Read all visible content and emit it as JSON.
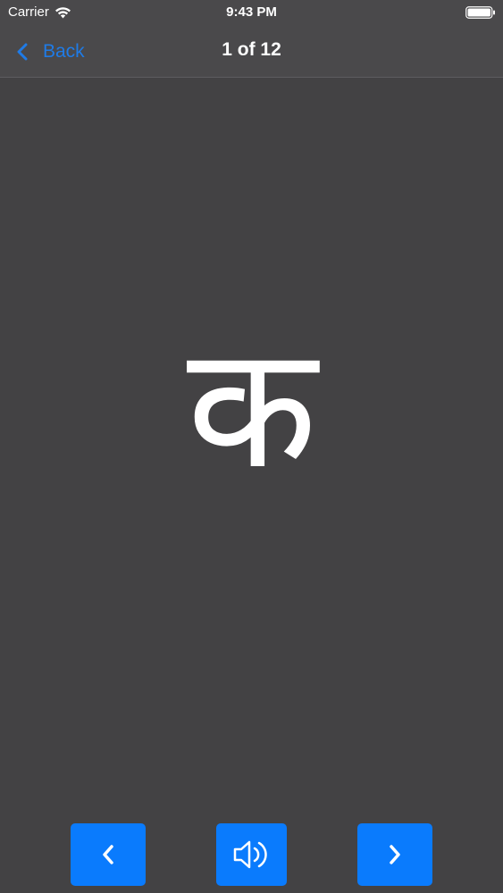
{
  "status_bar": {
    "carrier": "Carrier",
    "time": "9:43 PM",
    "wifi_icon": "wifi-icon",
    "battery_icon": "battery-icon"
  },
  "nav": {
    "back_label": "Back",
    "title": "1 of 12",
    "back_icon": "chevron-left-icon"
  },
  "content": {
    "letter": "क"
  },
  "controls": {
    "prev_icon": "chevron-left-icon",
    "sound_icon": "speaker-icon",
    "next_icon": "chevron-right-icon"
  },
  "colors": {
    "background": "#434244",
    "bar": "#4a494b",
    "accent": "#0a7bfd",
    "back_text": "#1f7be6",
    "text": "#ffffff"
  }
}
